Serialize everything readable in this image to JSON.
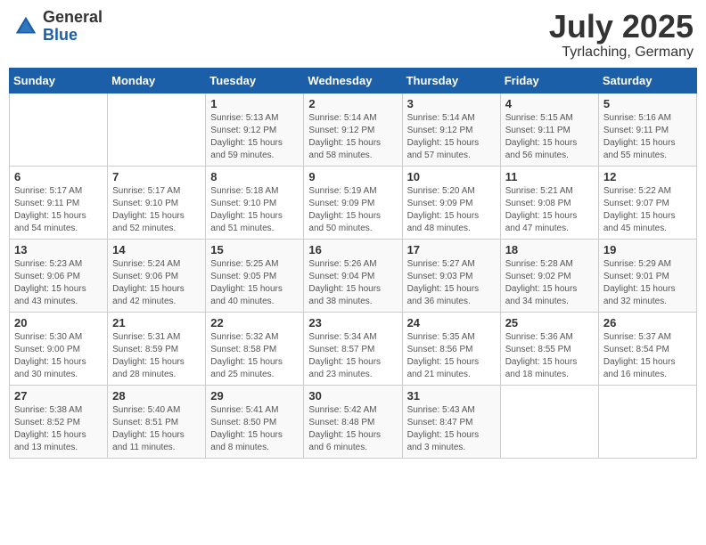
{
  "logo": {
    "general": "General",
    "blue": "Blue"
  },
  "title": "July 2025",
  "subtitle": "Tyrlaching, Germany",
  "days_of_week": [
    "Sunday",
    "Monday",
    "Tuesday",
    "Wednesday",
    "Thursday",
    "Friday",
    "Saturday"
  ],
  "weeks": [
    [
      {
        "day": "",
        "info": ""
      },
      {
        "day": "",
        "info": ""
      },
      {
        "day": "1",
        "info": "Sunrise: 5:13 AM\nSunset: 9:12 PM\nDaylight: 15 hours and 59 minutes."
      },
      {
        "day": "2",
        "info": "Sunrise: 5:14 AM\nSunset: 9:12 PM\nDaylight: 15 hours and 58 minutes."
      },
      {
        "day": "3",
        "info": "Sunrise: 5:14 AM\nSunset: 9:12 PM\nDaylight: 15 hours and 57 minutes."
      },
      {
        "day": "4",
        "info": "Sunrise: 5:15 AM\nSunset: 9:11 PM\nDaylight: 15 hours and 56 minutes."
      },
      {
        "day": "5",
        "info": "Sunrise: 5:16 AM\nSunset: 9:11 PM\nDaylight: 15 hours and 55 minutes."
      }
    ],
    [
      {
        "day": "6",
        "info": "Sunrise: 5:17 AM\nSunset: 9:11 PM\nDaylight: 15 hours and 54 minutes."
      },
      {
        "day": "7",
        "info": "Sunrise: 5:17 AM\nSunset: 9:10 PM\nDaylight: 15 hours and 52 minutes."
      },
      {
        "day": "8",
        "info": "Sunrise: 5:18 AM\nSunset: 9:10 PM\nDaylight: 15 hours and 51 minutes."
      },
      {
        "day": "9",
        "info": "Sunrise: 5:19 AM\nSunset: 9:09 PM\nDaylight: 15 hours and 50 minutes."
      },
      {
        "day": "10",
        "info": "Sunrise: 5:20 AM\nSunset: 9:09 PM\nDaylight: 15 hours and 48 minutes."
      },
      {
        "day": "11",
        "info": "Sunrise: 5:21 AM\nSunset: 9:08 PM\nDaylight: 15 hours and 47 minutes."
      },
      {
        "day": "12",
        "info": "Sunrise: 5:22 AM\nSunset: 9:07 PM\nDaylight: 15 hours and 45 minutes."
      }
    ],
    [
      {
        "day": "13",
        "info": "Sunrise: 5:23 AM\nSunset: 9:06 PM\nDaylight: 15 hours and 43 minutes."
      },
      {
        "day": "14",
        "info": "Sunrise: 5:24 AM\nSunset: 9:06 PM\nDaylight: 15 hours and 42 minutes."
      },
      {
        "day": "15",
        "info": "Sunrise: 5:25 AM\nSunset: 9:05 PM\nDaylight: 15 hours and 40 minutes."
      },
      {
        "day": "16",
        "info": "Sunrise: 5:26 AM\nSunset: 9:04 PM\nDaylight: 15 hours and 38 minutes."
      },
      {
        "day": "17",
        "info": "Sunrise: 5:27 AM\nSunset: 9:03 PM\nDaylight: 15 hours and 36 minutes."
      },
      {
        "day": "18",
        "info": "Sunrise: 5:28 AM\nSunset: 9:02 PM\nDaylight: 15 hours and 34 minutes."
      },
      {
        "day": "19",
        "info": "Sunrise: 5:29 AM\nSunset: 9:01 PM\nDaylight: 15 hours and 32 minutes."
      }
    ],
    [
      {
        "day": "20",
        "info": "Sunrise: 5:30 AM\nSunset: 9:00 PM\nDaylight: 15 hours and 30 minutes."
      },
      {
        "day": "21",
        "info": "Sunrise: 5:31 AM\nSunset: 8:59 PM\nDaylight: 15 hours and 28 minutes."
      },
      {
        "day": "22",
        "info": "Sunrise: 5:32 AM\nSunset: 8:58 PM\nDaylight: 15 hours and 25 minutes."
      },
      {
        "day": "23",
        "info": "Sunrise: 5:34 AM\nSunset: 8:57 PM\nDaylight: 15 hours and 23 minutes."
      },
      {
        "day": "24",
        "info": "Sunrise: 5:35 AM\nSunset: 8:56 PM\nDaylight: 15 hours and 21 minutes."
      },
      {
        "day": "25",
        "info": "Sunrise: 5:36 AM\nSunset: 8:55 PM\nDaylight: 15 hours and 18 minutes."
      },
      {
        "day": "26",
        "info": "Sunrise: 5:37 AM\nSunset: 8:54 PM\nDaylight: 15 hours and 16 minutes."
      }
    ],
    [
      {
        "day": "27",
        "info": "Sunrise: 5:38 AM\nSunset: 8:52 PM\nDaylight: 15 hours and 13 minutes."
      },
      {
        "day": "28",
        "info": "Sunrise: 5:40 AM\nSunset: 8:51 PM\nDaylight: 15 hours and 11 minutes."
      },
      {
        "day": "29",
        "info": "Sunrise: 5:41 AM\nSunset: 8:50 PM\nDaylight: 15 hours and 8 minutes."
      },
      {
        "day": "30",
        "info": "Sunrise: 5:42 AM\nSunset: 8:48 PM\nDaylight: 15 hours and 6 minutes."
      },
      {
        "day": "31",
        "info": "Sunrise: 5:43 AM\nSunset: 8:47 PM\nDaylight: 15 hours and 3 minutes."
      },
      {
        "day": "",
        "info": ""
      },
      {
        "day": "",
        "info": ""
      }
    ]
  ]
}
